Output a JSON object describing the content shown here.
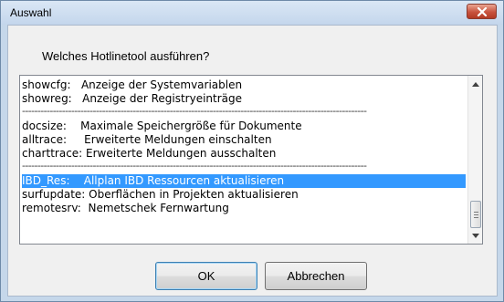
{
  "window": {
    "title": "Auswahl"
  },
  "dialog": {
    "prompt": "Welches Hotlinetool ausführen?"
  },
  "list": {
    "items": [
      {
        "text": "showcfg:   Anzeige der Systemvariablen",
        "selected": false
      },
      {
        "text": "showreg:   Anzeige der Registryeinträge",
        "selected": false
      },
      {
        "text": "----------------------------------------------------------------------------------------------------------------",
        "separator": true
      },
      {
        "text": "docsize:    Maximale Speichergröße für Dokumente",
        "selected": false
      },
      {
        "text": "alltrace:     Erweiterte Meldungen einschalten",
        "selected": false
      },
      {
        "text": "charttrace: Erweiterte Meldungen ausschalten",
        "selected": false
      },
      {
        "text": "----------------------------------------------------------------------------------------------------------------",
        "separator": true
      },
      {
        "text": "IBD_Res:    Allplan IBD Ressourcen aktualisieren",
        "selected": true
      },
      {
        "text": "surfupdate: Oberflächen in Projekten aktualisieren",
        "selected": false
      },
      {
        "text": "remotesrv:  Nemetschek Fernwartung",
        "selected": false
      }
    ]
  },
  "buttons": {
    "ok": "OK",
    "cancel": "Abbrechen"
  },
  "colors": {
    "selection": "#3399ff",
    "close_button": "#c8533e",
    "titlebar": "#c4d6ec"
  }
}
